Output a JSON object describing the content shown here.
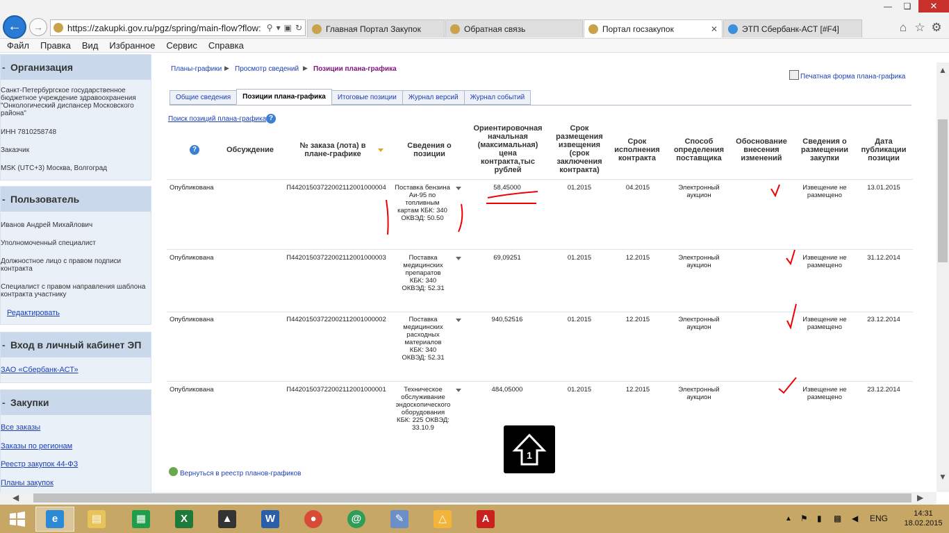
{
  "browser": {
    "url": "https://zakupki.gov.ru/pgz/spring/main-flow?flow:",
    "tabs": [
      "Главная Портал Закупок",
      "Обратная связь",
      "Портал госзакупок",
      "ЭТП Сбербанк-АСТ [#F4]"
    ],
    "menu": [
      "Файл",
      "Правка",
      "Вид",
      "Избранное",
      "Сервис",
      "Справка"
    ]
  },
  "sidebar": {
    "org_title": "Организация",
    "org_name": "Санкт-Петербургское государственное бюджетное учреждение здравоохранения \"Онкологический диспансер Московского района\"",
    "org_inn": "ИНН 7810258748",
    "org_role": "Заказчик",
    "org_tz": "MSK (UTC+3) Москва, Волгоград",
    "user_title": "Пользователь",
    "user_name": "Иванов Андрей Михайлович",
    "user_role1": "Уполномоченный специалист",
    "user_role2": "Должностное лицо с правом подписи контракта",
    "user_role3": "Специалист с правом направления шаблона контракта участнику",
    "user_edit": "Редактировать",
    "ep_title": "Вход в личный кабинет ЭП",
    "ep_link": "ЗАО «Сбербанк-АСТ»",
    "purch_title": "Закупки",
    "purch_links": [
      "Все заказы",
      "Заказы по регионам",
      "Реестр закупок 44-ФЗ",
      "Планы закупок"
    ]
  },
  "main": {
    "breadcrumb": [
      "Планы-графики",
      "Просмотр сведений",
      "Позиции плана-графика"
    ],
    "print_link": "Печатная форма плана-графика",
    "tabs": [
      "Общие сведения",
      "Позиции плана-графика",
      "Итоговые позиции",
      "Журнал версий",
      "Журнал событий"
    ],
    "search_link": "Поиск позиций плана-графика",
    "headers": {
      "discuss": "Обсуждение",
      "order": "№ заказа (лота) в плане-графике",
      "info": "Сведения о позиции",
      "price": "Ориентировочная начальная (максимальная) цена контракта,тыс рублей",
      "notice": "Срок размещения извещения (срок заключения контракта)",
      "term": "Срок исполнения контракта",
      "method": "Способ определения поставщика",
      "reason": "Обоснование внесения изменений",
      "placement": "Сведения о размещении закупки",
      "pubdate": "Дата публикации позиции"
    },
    "rows": [
      {
        "status": "Опубликована",
        "order": "П44201503722002112001000004",
        "info": "Поставка бензина Аи-95 по топливным картам КБК: 340 ОКВЭД: 50.50",
        "price": "58,45000",
        "notice": "01.2015",
        "term": "04.2015",
        "method": "Электронный аукцион",
        "placement": "Извещение не размещено",
        "pubdate": "13.01.2015"
      },
      {
        "status": "Опубликована",
        "order": "П44201503722002112001000003",
        "info": "Поставка медицинских препаратов КБК: 340 ОКВЭД: 52.31",
        "price": "69,09251",
        "notice": "01.2015",
        "term": "12.2015",
        "method": "Электронный аукцион",
        "placement": "Извещение не размещено",
        "pubdate": "31.12.2014"
      },
      {
        "status": "Опубликована",
        "order": "П44201503722002112001000002",
        "info": "Поставка медицинских расходных материалов КБК: 340 ОКВЭД: 52.31",
        "price": "940,52516",
        "notice": "01.2015",
        "term": "12.2015",
        "method": "Электронный аукцион",
        "placement": "Извещение не размещено",
        "pubdate": "23.12.2014"
      },
      {
        "status": "Опубликована",
        "order": "П44201503722002112001000001",
        "info": "Техническое обслуживание эндоскопического оборудования КБК: 225 ОКВЭД: 33.10.9",
        "price": "484,05000",
        "notice": "01.2015",
        "term": "12.2015",
        "method": "Электронный аукцион",
        "placement": "Извещение не размещено",
        "pubdate": "23.12.2014"
      }
    ],
    "back_link": "Вернуться в реестр планов-графиков"
  },
  "taskbar": {
    "lang": "ENG",
    "time": "14:31",
    "date": "18.02.2015"
  }
}
